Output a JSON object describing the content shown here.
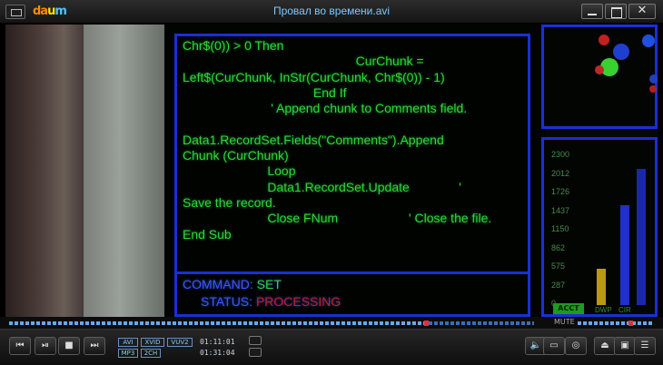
{
  "window": {
    "title": "Провал во времени.avi",
    "logo": [
      "da",
      "u",
      "m"
    ],
    "close_glyph": "✕"
  },
  "video": {
    "code_lines": [
      "Chr$(0)) > 0 Then",
      "                                                 CurChunk =",
      "Left$(CurChunk, InStr(CurChunk, Chr$(0)) - 1)",
      "                                     End If",
      "                         ' Append chunk to Comments field.",
      "",
      "Data1.RecordSet.Fields(\"Comments\").Append",
      "Chunk (CurChunk)",
      "                        Loop",
      "                        Data1.RecordSet.Update              '",
      "Save the record.",
      "                        Close FNum                    ' Close the file.",
      "End Sub"
    ],
    "command_label": "COMMAND:",
    "command_value": "SET",
    "status_label": "STATUS:",
    "status_value": "PROCESSING",
    "scale_values": [
      "2300",
      "2012",
      "1726",
      "1437",
      "1150",
      "862",
      "575",
      "287",
      "0"
    ],
    "meter_labels": [
      "ACCT",
      "DWP",
      "CIR"
    ]
  },
  "playback": {
    "progress": 0.79,
    "volume": 0.67,
    "mute_label": "MUTE",
    "current_time": "01:11:01",
    "total_time": "01:31:04",
    "tags": [
      "AVI",
      "XVID",
      "VUV2",
      "MP3",
      "2CH"
    ]
  },
  "controls": {
    "prev": "⏮",
    "play_pause": "⏯",
    "stop": "■",
    "next": "⏭",
    "volume_icon": "🔈",
    "subtitle_icon": "▭",
    "settings_icon": "◎",
    "eject_icon": "⏏",
    "capture_icon": "▣",
    "playlist_icon": "☰"
  },
  "colors": {
    "code_green": "#2ed53a",
    "screen_border": "#1a2fd6",
    "title_blue": "#7ec8ff",
    "seek_blue": "#6aa8e8",
    "seek_knob": "#dd3333"
  }
}
